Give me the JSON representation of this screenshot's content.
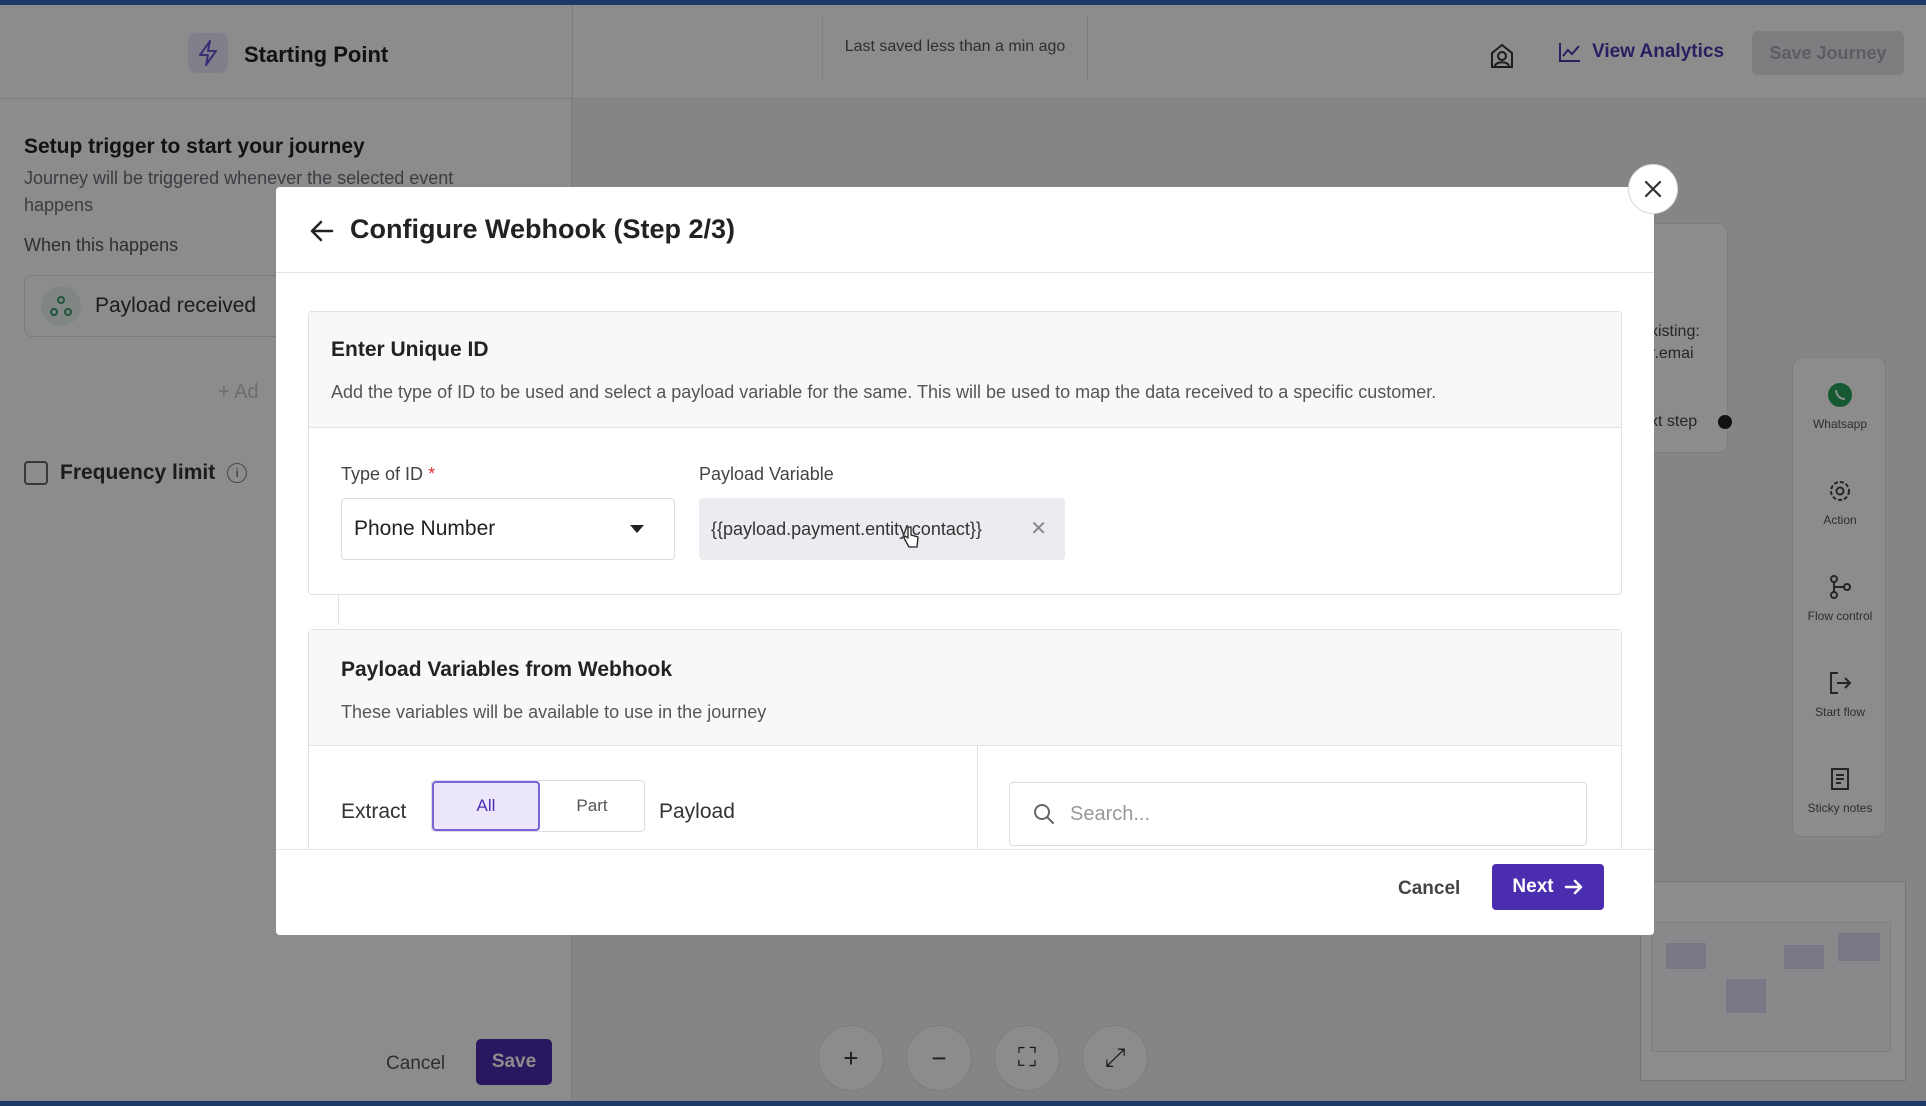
{
  "topbar": {
    "title": "Starting Point",
    "saved_status": "Last saved less than a min ago",
    "analytics_label": "View Analytics",
    "save_journey_label": "Save Journey"
  },
  "left_panel": {
    "heading": "Setup trigger to start your journey",
    "subheading": "Journey will be triggered whenever the selected event happens",
    "when_label": "When this happens",
    "trigger_label": "Payload received",
    "add_label": "+ Ad",
    "frequency_label": "Frequency limit",
    "cancel_label": "Cancel",
    "save_label": "Save"
  },
  "canvas": {
    "card_text_line1": "xisting:",
    "card_text_line2": "r.emai",
    "card_next_step": "xt step"
  },
  "palette": {
    "items": [
      {
        "label": "Whatsapp",
        "icon": "whatsapp-icon"
      },
      {
        "label": "Action",
        "icon": "gear-icon"
      },
      {
        "label": "Flow control",
        "icon": "branch-icon"
      },
      {
        "label": "Start flow",
        "icon": "exit-icon"
      },
      {
        "label": "Sticky notes",
        "icon": "note-icon"
      }
    ]
  },
  "zoom_controls": {
    "zoom_in": "+",
    "zoom_out": "−",
    "fit": "⛶",
    "expand": "⤢"
  },
  "modal": {
    "title": "Configure Webhook (Step 2/3)",
    "unique_id": {
      "title": "Enter Unique ID",
      "description": "Add the type of ID to be used and select a payload variable for the same. This will be used to map the data received to a specific customer.",
      "type_label": "Type of ID",
      "required_mark": "*",
      "type_value": "Phone Number",
      "payload_label": "Payload Variable",
      "payload_value": "{{payload.payment.entity.contact}}"
    },
    "payload_vars": {
      "title": "Payload Variables from Webhook",
      "description": "These variables will be available to use in the journey",
      "extract_label": "Extract",
      "option_all": "All",
      "option_part": "Part",
      "payload_label": "Payload",
      "search_placeholder": "Search..."
    },
    "footer": {
      "cancel_label": "Cancel",
      "next_label": "Next"
    }
  },
  "colors": {
    "brand": "#4b2db0",
    "analytics": "#4b3ab0",
    "selected_bg": "#ebe6fb"
  }
}
